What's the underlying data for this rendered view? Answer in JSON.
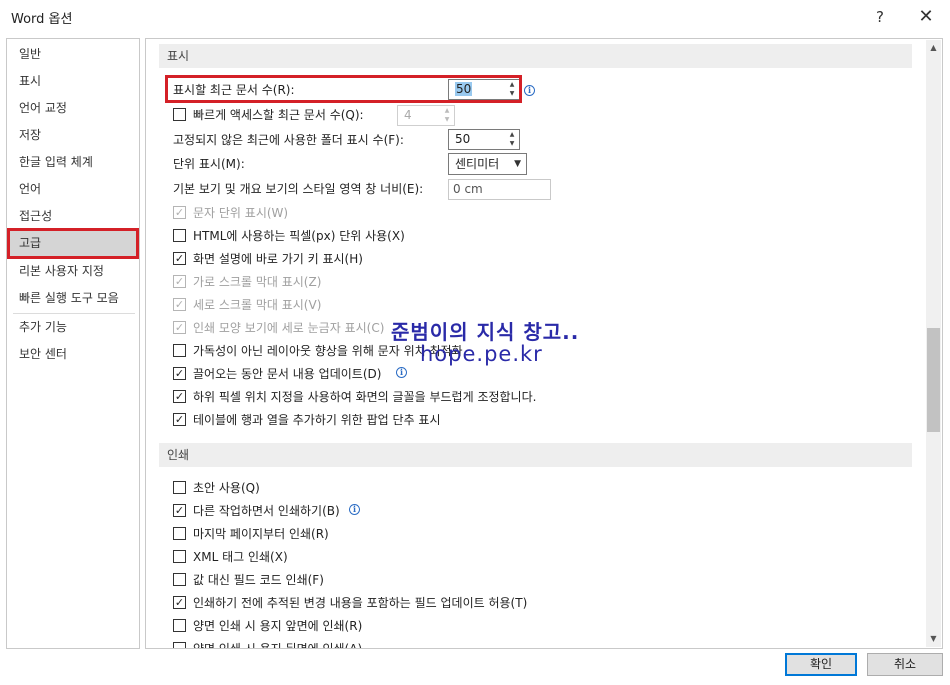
{
  "window": {
    "title": "Word 옵션",
    "help_label": "?",
    "close_label": "✕"
  },
  "sidebar": {
    "items": [
      {
        "label": "일반"
      },
      {
        "label": "표시"
      },
      {
        "label": "언어 교정"
      },
      {
        "label": "저장"
      },
      {
        "label": "한글 입력 체계"
      },
      {
        "label": "언어"
      },
      {
        "label": "접근성"
      },
      {
        "label": "고급",
        "selected": true
      },
      {
        "label": "리본 사용자 지정"
      },
      {
        "label": "빠른 실행 도구 모음"
      },
      {
        "label": "추가 기능"
      },
      {
        "label": "보안 센터"
      }
    ]
  },
  "display_section": {
    "header": "표시",
    "recent_docs": {
      "label": "표시할 최근 문서 수(R):",
      "value": "50"
    },
    "quick_access": {
      "label": "빠르게 액세스할 최근 문서 수(Q):",
      "value": "4",
      "checked": false
    },
    "unpinned_folders": {
      "label": "고정되지 않은 최근에 사용한 폴더 표시 수(F):",
      "value": "50"
    },
    "units": {
      "label": "단위 표시(M):",
      "value": "센티미터"
    },
    "style_pane": {
      "label": "기본 보기 및 개요 보기의 스타일 영역 창 너비(E):",
      "value": "0 cm"
    },
    "checks": [
      {
        "label": "문자 단위 표시(W)",
        "checked": true,
        "disabled": true
      },
      {
        "label": "HTML에 사용하는 픽셀(px) 단위 사용(X)",
        "checked": false,
        "disabled": false
      },
      {
        "label": "화면 설명에 바로 가기 키 표시(H)",
        "checked": true,
        "disabled": false
      },
      {
        "label": "가로 스크롤 막대 표시(Z)",
        "checked": true,
        "disabled": true
      },
      {
        "label": "세로 스크롤 막대 표시(V)",
        "checked": true,
        "disabled": true
      },
      {
        "label": "인쇄 모양 보기에 세로 눈금자 표시(C)",
        "checked": true,
        "disabled": true
      },
      {
        "label": "가독성이 아닌 레이아웃 향상을 위해 문자 위치 최적화",
        "checked": false,
        "disabled": false
      },
      {
        "label": "끌어오는 동안 문서 내용 업데이트(D)",
        "checked": true,
        "disabled": false,
        "info": true
      },
      {
        "label": "하위 픽셀 위치 지정을 사용하여 화면의 글꼴을 부드럽게 조정합니다.",
        "checked": true,
        "disabled": false
      },
      {
        "label": "테이블에 행과 열을 추가하기 위한 팝업 단추 표시",
        "checked": true,
        "disabled": false
      }
    ]
  },
  "print_section": {
    "header": "인쇄",
    "checks": [
      {
        "label": "초안 사용(Q)",
        "checked": false
      },
      {
        "label": "다른 작업하면서 인쇄하기(B)",
        "checked": true,
        "info": true
      },
      {
        "label": "마지막 페이지부터 인쇄(R)",
        "checked": false
      },
      {
        "label": "XML 태그 인쇄(X)",
        "checked": false
      },
      {
        "label": "값 대신 필드 코드 인쇄(F)",
        "checked": false
      },
      {
        "label": "인쇄하기 전에 추적된 변경 내용을 포함하는 필드 업데이트 허용(T)",
        "checked": true
      },
      {
        "label": "양면 인쇄 시 용지 앞면에 인쇄(R)",
        "checked": false
      },
      {
        "label": "양면 인쇄 시 용지 뒤면에 인쇄(A)",
        "checked": false
      }
    ]
  },
  "watermark": {
    "line1": "준범이의 지식 창고..",
    "line2": "hope.pe.kr"
  },
  "buttons": {
    "ok": "확인",
    "cancel": "취소"
  },
  "glyphs": {
    "check": "✓",
    "spin_up": "▲",
    "spin_down": "▼",
    "dropdown": "▼",
    "info": "i"
  }
}
